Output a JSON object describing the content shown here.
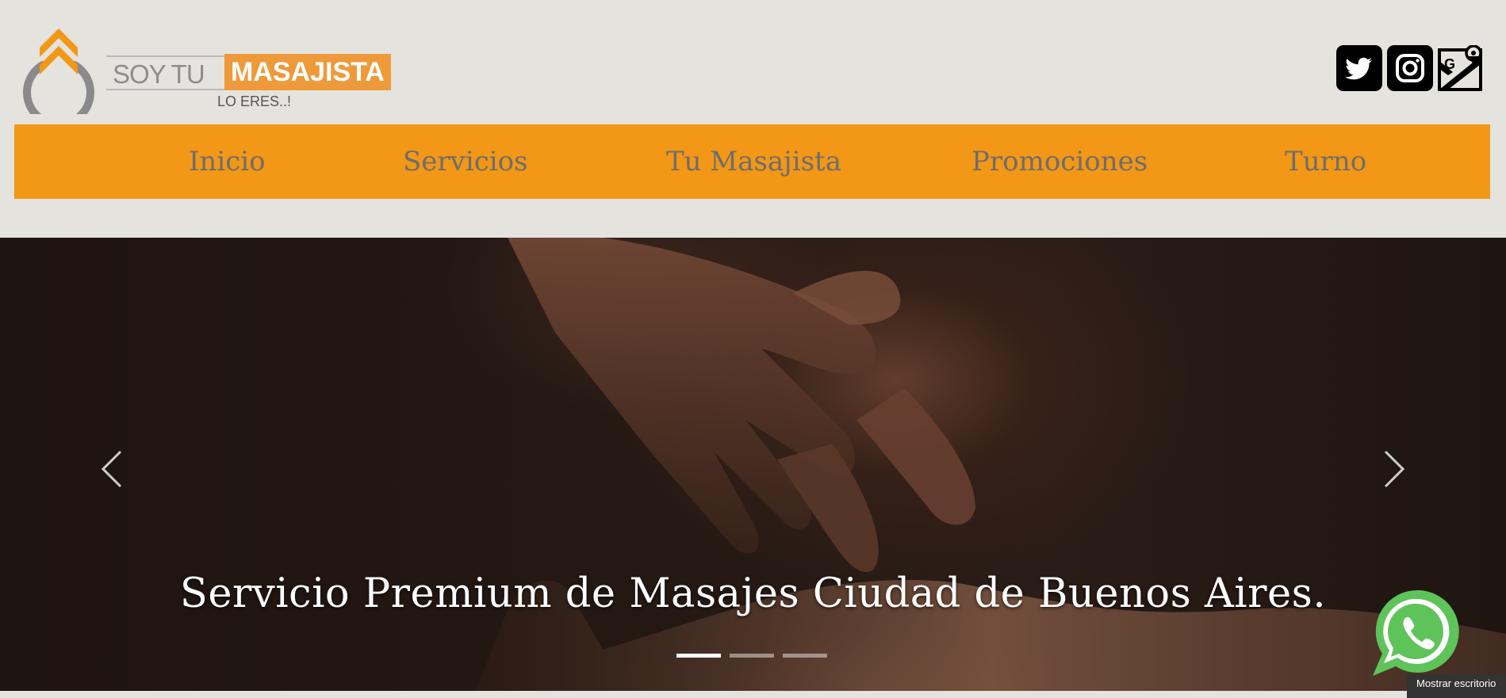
{
  "brand": {
    "part1": "SOY TU",
    "part2": "MASAJISTA",
    "tagline": "LO ERES..!",
    "accent_color": "#f29716",
    "logo_orange": "#ef9a3a"
  },
  "social": [
    {
      "icon": "twitter-icon",
      "label": "Twitter"
    },
    {
      "icon": "instagram-icon",
      "label": "Instagram"
    },
    {
      "icon": "google-maps-icon",
      "label": "Google Maps"
    }
  ],
  "nav": {
    "items": [
      {
        "label": "Inicio"
      },
      {
        "label": "Servicios"
      },
      {
        "label": "Tu Masajista"
      },
      {
        "label": "Promociones"
      },
      {
        "label": "Turno"
      }
    ]
  },
  "hero": {
    "caption": "Servicio Premium de Masajes Ciudad de Buenos Aires.",
    "slide_count": 3,
    "active_slide": 1,
    "prev_icon": "chevron-left-icon",
    "next_icon": "chevron-right-icon"
  },
  "whatsapp": {
    "icon": "whatsapp-icon",
    "color": "#5ec45a"
  },
  "toast": {
    "text": "Mostrar escritorio"
  }
}
